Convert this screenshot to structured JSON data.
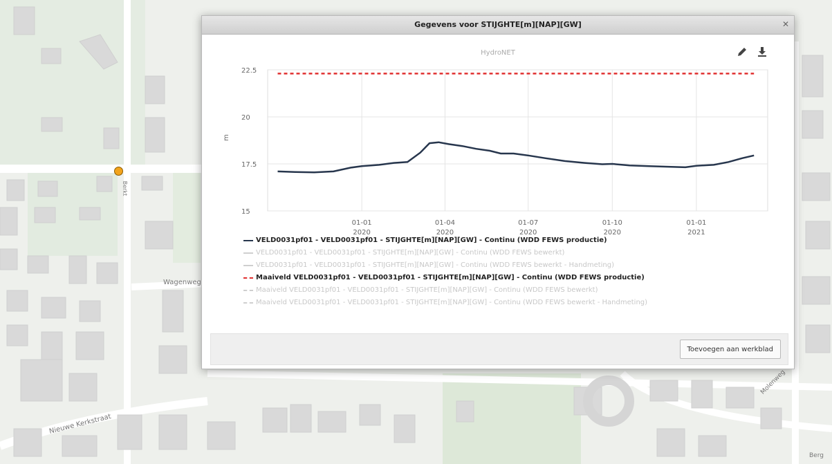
{
  "map": {
    "street_labels": [
      "Berkt",
      "Wagenweg",
      "Nieuwe Kerkstraat",
      "Molenweg",
      "Berg"
    ],
    "marker_color": "#f2a31b"
  },
  "dialog": {
    "title": "Gegevens voor STIJGHTE[m][NAP][GW]",
    "close_icon": "close-icon",
    "edit_icon": "pencil-icon",
    "download_icon": "download-icon",
    "add_button_label": "Toevoegen aan werkblad"
  },
  "chart_data": {
    "type": "line",
    "title": "HydroNET",
    "ylabel": "m",
    "ylim": [
      15,
      22.5
    ],
    "yticks": [
      "15",
      "17.5",
      "20",
      "22.5"
    ],
    "xticks": [
      {
        "line1": "01-01",
        "line2": "2020"
      },
      {
        "line1": "01-04",
        "line2": "2020"
      },
      {
        "line1": "01-07",
        "line2": "2020"
      },
      {
        "line1": "01-10",
        "line2": "2020"
      },
      {
        "line1": "01-01",
        "line2": "2021"
      }
    ],
    "grid": true,
    "series": [
      {
        "name": "VELD0031pf01 - VELD0031pf01 - STIJGHTE[m][NAP][GW] - Continu (WDD FEWS productie)",
        "color": "#27364d",
        "dash": false,
        "x": [
          "2019-10-01",
          "2019-10-20",
          "2019-11-10",
          "2019-12-01",
          "2019-12-20",
          "2020-01-01",
          "2020-01-20",
          "2020-02-05",
          "2020-02-20",
          "2020-03-05",
          "2020-03-15",
          "2020-03-25",
          "2020-04-05",
          "2020-04-20",
          "2020-05-05",
          "2020-05-20",
          "2020-06-01",
          "2020-06-15",
          "2020-07-01",
          "2020-07-20",
          "2020-08-10",
          "2020-09-01",
          "2020-09-20",
          "2020-10-01",
          "2020-10-20",
          "2020-11-10",
          "2020-12-01",
          "2020-12-20",
          "2021-01-01",
          "2021-01-20",
          "2021-02-05",
          "2021-02-20",
          "2021-03-05"
        ],
        "y": [
          17.1,
          17.07,
          17.05,
          17.1,
          17.3,
          17.38,
          17.45,
          17.55,
          17.6,
          18.1,
          18.6,
          18.65,
          18.55,
          18.45,
          18.3,
          18.2,
          18.05,
          18.05,
          17.95,
          17.8,
          17.65,
          17.55,
          17.48,
          17.5,
          17.42,
          17.38,
          17.35,
          17.32,
          17.4,
          17.45,
          17.6,
          17.8,
          17.95
        ]
      },
      {
        "name": "VELD0031pf01 - VELD0031pf01 - STIJGHTE[m][NAP][GW] - Continu (WDD FEWS bewerkt)",
        "color": "#cfcfcf",
        "dash": false,
        "x": [],
        "y": []
      },
      {
        "name": "VELD0031pf01 - VELD0031pf01 - STIJGHTE[m][NAP][GW] - Continu (WDD FEWS bewerkt - Handmeting)",
        "color": "#cfcfcf",
        "dash": false,
        "x": [],
        "y": []
      },
      {
        "name": "Maaiveld VELD0031pf01 - VELD0031pf01 - STIJGHTE[m][NAP][GW] - Continu (WDD FEWS productie)",
        "color": "#e03030",
        "dash": true,
        "x": [
          "2019-10-01",
          "2021-03-05"
        ],
        "y": [
          22.3,
          22.3
        ]
      },
      {
        "name": "Maaiveld VELD0031pf01 - VELD0031pf01 - STIJGHTE[m][NAP][GW] - Continu (WDD FEWS bewerkt)",
        "color": "#cfcfcf",
        "dash": true,
        "x": [],
        "y": []
      },
      {
        "name": "Maaiveld VELD0031pf01 - VELD0031pf01 - STIJGHTE[m][NAP][GW] - Continu (WDD FEWS bewerkt - Handmeting)",
        "color": "#cfcfcf",
        "dash": true,
        "x": [],
        "y": []
      }
    ]
  }
}
